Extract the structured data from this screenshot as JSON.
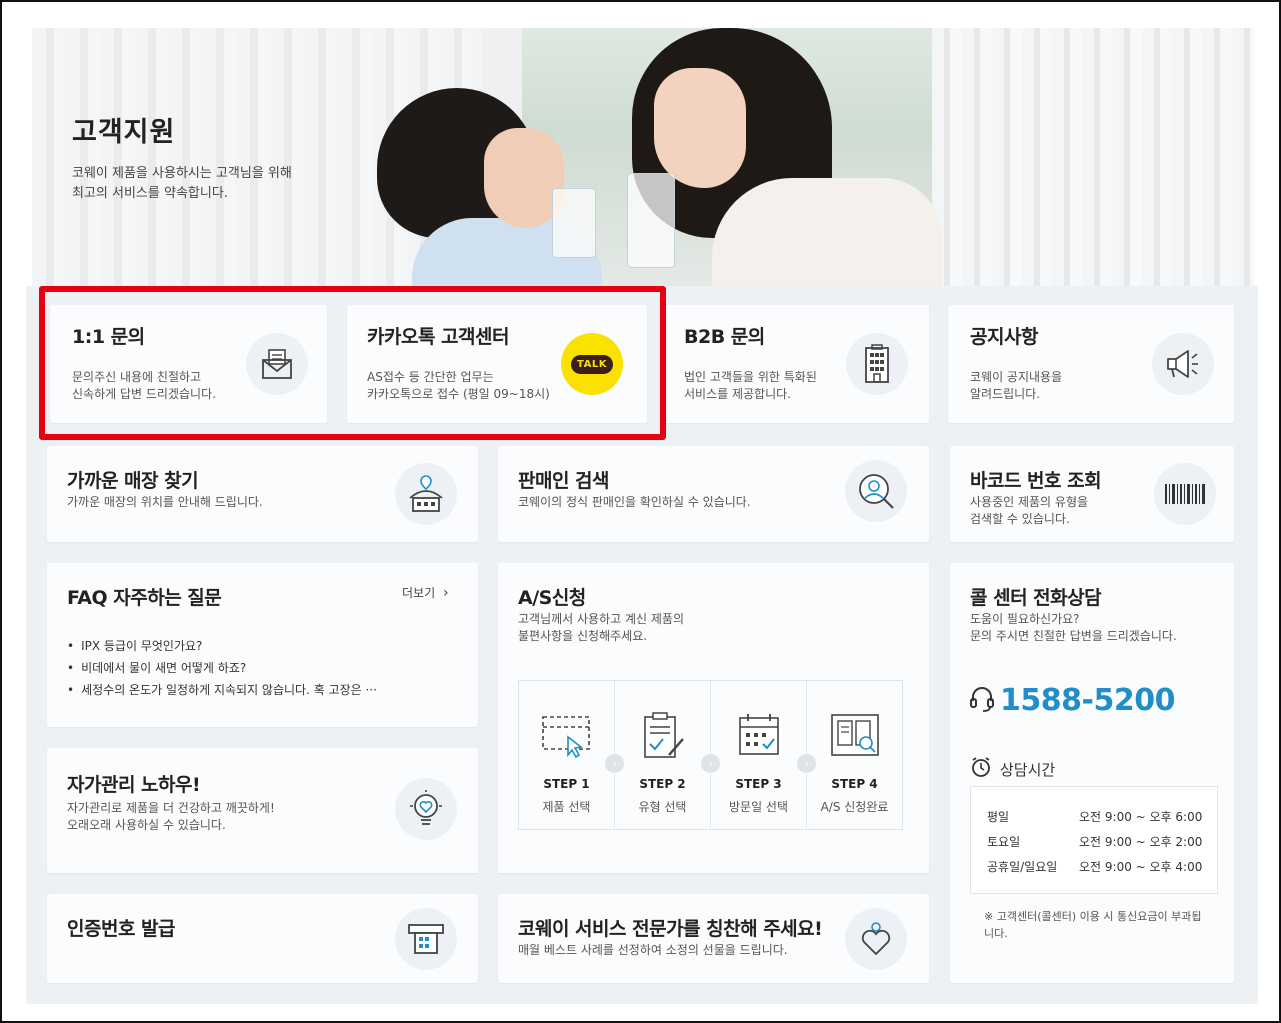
{
  "hero": {
    "title": "고객지원",
    "desc_line1": "코웨이 제품을 사용하시는 고객님을 위해",
    "desc_line2": "최고의 서비스를 약속합니다."
  },
  "top_cards": [
    {
      "title": "1:1 문의",
      "desc1": "문의주신 내용에 친절하고",
      "desc2": "신속하게 답변 드리겠습니다.",
      "icon": "envelope-icon"
    },
    {
      "title": "카카오톡 고객센터",
      "desc1": "AS접수 등 간단한 업무는",
      "desc2": "카카오톡으로 접수 (평일 09~18시)",
      "icon": "kakao-talk-icon",
      "badge": "TALK"
    },
    {
      "title": "B2B 문의",
      "desc1": "법인 고객들을 위한 특화된",
      "desc2": "서비스를 제공합니다.",
      "icon": "building-icon"
    },
    {
      "title": "공지사항",
      "desc1": "코웨이 공지내용을",
      "desc2": "알려드립니다.",
      "icon": "megaphone-icon"
    }
  ],
  "store": {
    "title": "가까운 매장 찾기",
    "desc": "가까운 매장의 위치를 안내해 드립니다."
  },
  "seller": {
    "title": "판매인 검색",
    "desc": "코웨이의 정식 판매인을 확인하실 수 있습니다."
  },
  "barcode": {
    "title": "바코드 번호 조회",
    "desc1": "사용중인 제품의 유형을",
    "desc2": "검색할 수 있습니다."
  },
  "faq": {
    "title": "FAQ 자주하는 질문",
    "more": "더보기",
    "items": [
      "IPX 등급이 무엇인가요?",
      "비데에서 물이 새면 어떻게 하죠?",
      "세정수의 온도가 일정하게 지속되지 않습니다. 혹 고장은 ···"
    ]
  },
  "as": {
    "title": "A/S신청",
    "desc1": "고객님께서 사용하고 계신 제품의",
    "desc2": "불편사항을 신청해주세요.",
    "steps": [
      {
        "num": "STEP 1",
        "label": "제품 선택"
      },
      {
        "num": "STEP 2",
        "label": "유형 선택"
      },
      {
        "num": "STEP 3",
        "label": "방문일 선택"
      },
      {
        "num": "STEP 4",
        "label": "A/S 신청완료"
      }
    ]
  },
  "call": {
    "title": "콜 센터 전화상담",
    "desc1": "도움이 필요하신가요?",
    "desc2": "문의 주시면 친절한 답변을 드리겠습니다.",
    "phone": "1588-5200",
    "hours_title": "상담시간",
    "hours": [
      {
        "day": "평일",
        "time": "오전 9:00 ~ 오후 6:00"
      },
      {
        "day": "토요일",
        "time": "오전 9:00 ~ 오후 2:00"
      },
      {
        "day": "공휴일/일요일",
        "time": "오전 9:00 ~ 오후 4:00"
      }
    ],
    "note": "※ 고객센터(콜센터) 이용 시 통신요금이 부과됩니다."
  },
  "selfcare": {
    "title": "자가관리 노하우!",
    "desc1": "자가관리로 제품을 더 건강하고 깨끗하게!",
    "desc2": "오래오래 사용하실 수 있습니다."
  },
  "auth": {
    "title": "인증번호 발급"
  },
  "praise": {
    "title": "코웨이 서비스 전문가를 칭찬해 주세요!",
    "desc": "매월 베스트 사례를 선정하여 소정의 선물을 드립니다."
  },
  "colors": {
    "accent": "#1f8ec9",
    "highlight": "#e60012",
    "kakao": "#fae100"
  }
}
